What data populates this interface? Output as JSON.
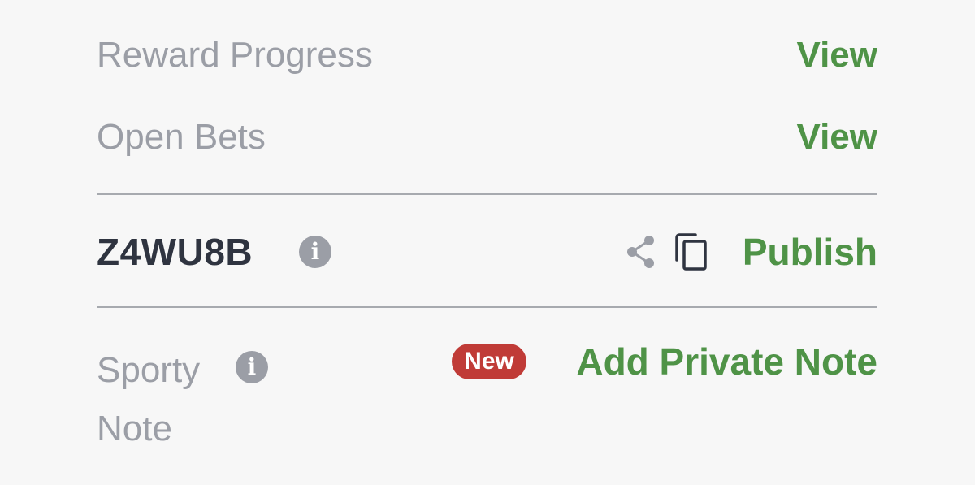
{
  "reward_progress": {
    "label": "Reward Progress",
    "action": "View"
  },
  "open_bets": {
    "label": "Open Bets",
    "action": "View"
  },
  "booking": {
    "code": "Z4WU8B",
    "info_icon": "info-icon",
    "share_icon": "share-icon",
    "copy_icon": "copy-icon",
    "action": "Publish"
  },
  "note": {
    "label": "Sporty Note",
    "info_icon": "info-icon",
    "badge": "New",
    "action": "Add Private Note"
  },
  "colors": {
    "background": "#f7f7f7",
    "label_gray": "#9b9ea6",
    "link_green": "#4f9347",
    "code_dark": "#2f3440",
    "badge_red": "#c03b37",
    "divider": "#a7aaaf"
  }
}
